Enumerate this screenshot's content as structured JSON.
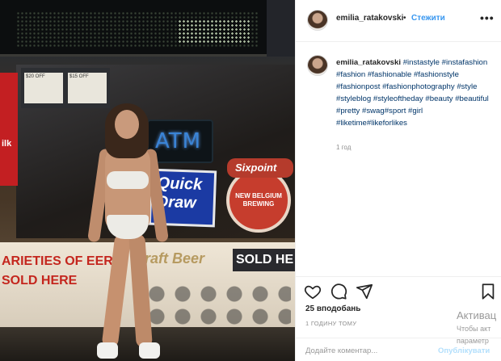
{
  "post": {
    "username": "emilia_ratakovski",
    "separator": "•",
    "follow_label": "Стежити",
    "more_icon": "more-options-icon",
    "caption_username": "emilia_ratakovski",
    "caption_hashtags": "#instastyle #instafashion #fashion #fashionable #fashionstyle #fashionpost #fashionphotography #style #styleblog #styleoftheday #beauty #beautiful #pretty #swag#sport #girl #liketime#likeforlikes",
    "caption_age": "1 год",
    "likes": "25 вподобань",
    "timestamp": "1 ГОДИНУ ТОМУ",
    "comment_placeholder": "Додайте коментар...",
    "publish_label": "Опублікувати"
  },
  "photo": {
    "sign_red_panel": "ilk",
    "shelf_card_1": "$20 OFF",
    "shelf_card_2": "$15 OFF",
    "atm": "ATM",
    "quick_draw": "Quick Draw",
    "sixpoint": "Sixpoint",
    "new_belgium": "NEW BELGIUM BREWING",
    "varieties": "ARIETIES OF EER SOLD HERE",
    "craft_beer": "Craft Beer",
    "sold_here": "SOLD HE"
  },
  "overlay": {
    "activate_title": "Активац",
    "activate_line1": "Чтобы акт",
    "activate_line2": "параметр"
  },
  "icons": [
    "heart-icon",
    "comment-icon",
    "share-icon",
    "bookmark-icon"
  ],
  "colors": {
    "link_blue": "#3897f0",
    "hashtag_blue": "#003569",
    "muted_gray": "#8e8e8e",
    "publish_disabled": "#b2dffc"
  }
}
